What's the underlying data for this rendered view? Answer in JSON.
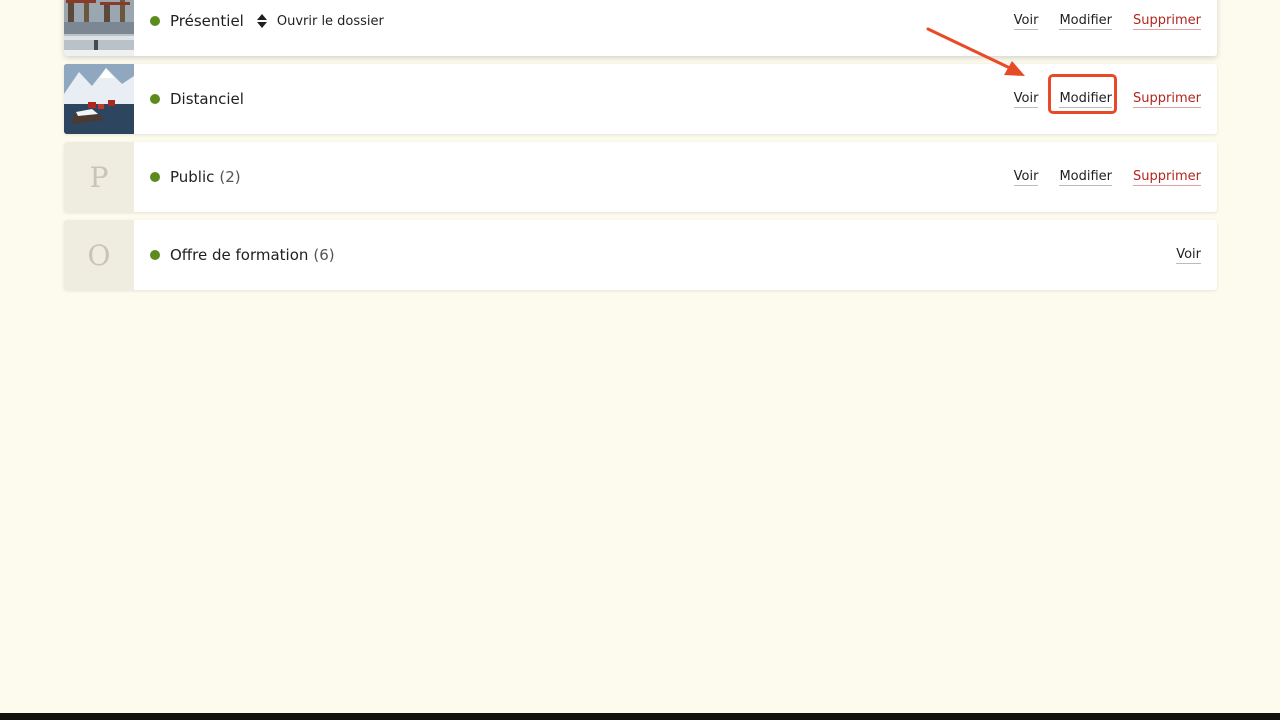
{
  "colors": {
    "accent": "#e84a27",
    "status": "#5c8a1c",
    "danger": "#b3261e",
    "background": "#fdfbee"
  },
  "rows": [
    {
      "title": "Présentiel",
      "count": "",
      "thumb": "image-harbor-cranes",
      "sort_icon": "sort-updown-icon",
      "open_folder": "Ouvrir le dossier",
      "actions": {
        "view": "Voir",
        "edit": "Modifier",
        "delete": "Supprimer"
      }
    },
    {
      "title": "Distanciel",
      "count": "",
      "thumb": "image-snowy-village",
      "actions": {
        "view": "Voir",
        "edit": "Modifier",
        "delete": "Supprimer"
      }
    },
    {
      "title": "Public",
      "count": "(2)",
      "thumb_letter": "P",
      "actions": {
        "view": "Voir",
        "edit": "Modifier",
        "delete": "Supprimer"
      }
    },
    {
      "title": "Offre de formation",
      "count": "(6)",
      "thumb_letter": "O",
      "actions": {
        "view": "Voir"
      }
    }
  ],
  "annotation": {
    "target": "Modifier",
    "icon": "arrow-icon"
  }
}
